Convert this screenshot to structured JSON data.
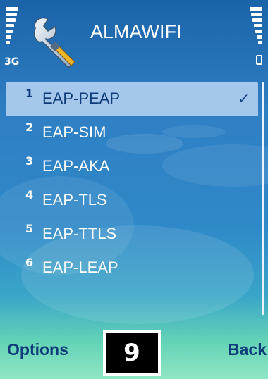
{
  "statusbar": {
    "network": "3G"
  },
  "header": {
    "title": "ALMAWIFI",
    "icon": "wrench-settings-icon"
  },
  "list": {
    "items": [
      {
        "num": "1",
        "label": "EAP-PEAP",
        "selected": true
      },
      {
        "num": "2",
        "label": "EAP-SIM"
      },
      {
        "num": "3",
        "label": "EAP-AKA"
      },
      {
        "num": "4",
        "label": "EAP-TLS"
      },
      {
        "num": "5",
        "label": "EAP-TTLS"
      },
      {
        "num": "6",
        "label": "EAP-LEAP"
      }
    ],
    "selected_mark": "✓"
  },
  "softkeys": {
    "left": "Options",
    "right": "Back"
  },
  "overlay": {
    "key_number": "9"
  },
  "colors": {
    "selected_bg": "#a6c7ec",
    "softkey_text": "#0e3d7a"
  }
}
